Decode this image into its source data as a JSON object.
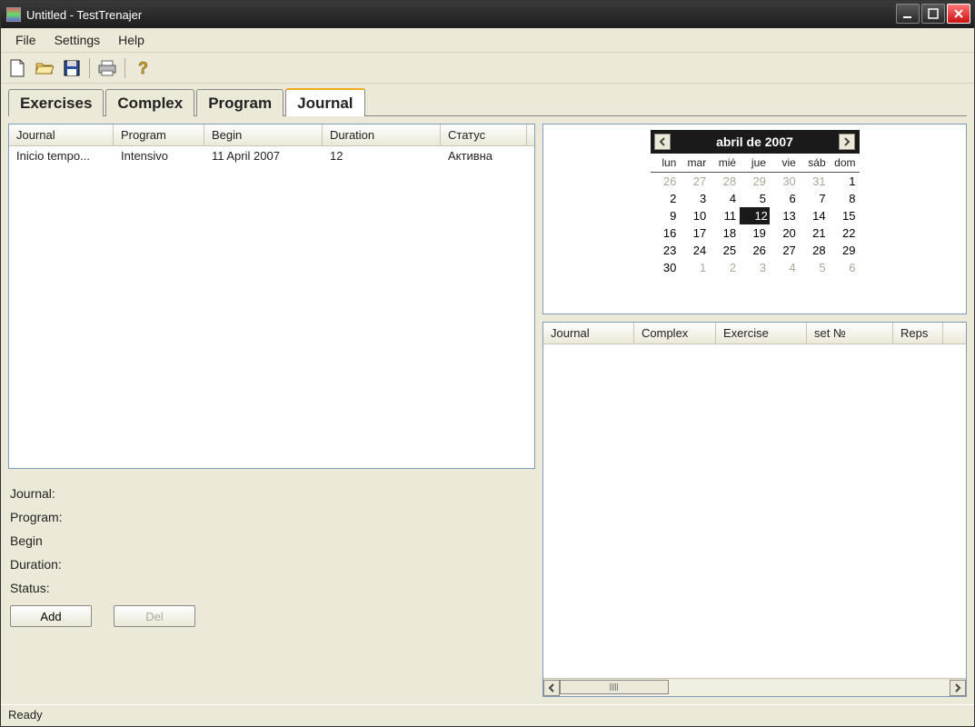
{
  "window": {
    "title": "Untitled - TestTrenajer"
  },
  "menubar": {
    "file": "File",
    "settings": "Settings",
    "help": "Help"
  },
  "toolbar": {
    "new": "new-file-icon",
    "open": "open-file-icon",
    "save": "save-icon",
    "print": "print-icon",
    "help": "help-icon"
  },
  "tabs": {
    "exercises": "Exercises",
    "complex": "Complex",
    "program": "Program",
    "journal": "Journal",
    "active": "journal"
  },
  "journal_list": {
    "columns": {
      "journal": "Journal",
      "program": "Program",
      "begin": "Begin",
      "duration": "Duration",
      "status": "Статус"
    },
    "rows": [
      {
        "journal": "Inicio tempo...",
        "program": "Intensivo",
        "begin": "11 April 2007",
        "duration": "12",
        "status": "Активна"
      }
    ]
  },
  "form": {
    "journal_label": "Journal:",
    "program_label": "Program:",
    "begin_label": "Begin",
    "duration_label": "Duration:",
    "status_label": "Status:",
    "add_btn": "Add",
    "del_btn": "Del"
  },
  "calendar": {
    "title": "abril de 2007",
    "dow": [
      "lun",
      "mar",
      "mié",
      "jue",
      "vie",
      "sáb",
      "dom"
    ],
    "cells": [
      {
        "d": "26",
        "o": true
      },
      {
        "d": "27",
        "o": true
      },
      {
        "d": "28",
        "o": true
      },
      {
        "d": "29",
        "o": true
      },
      {
        "d": "30",
        "o": true
      },
      {
        "d": "31",
        "o": true
      },
      {
        "d": "1"
      },
      {
        "d": "2"
      },
      {
        "d": "3"
      },
      {
        "d": "4"
      },
      {
        "d": "5"
      },
      {
        "d": "6"
      },
      {
        "d": "7"
      },
      {
        "d": "8"
      },
      {
        "d": "9"
      },
      {
        "d": "10"
      },
      {
        "d": "11"
      },
      {
        "d": "12",
        "sel": true
      },
      {
        "d": "13"
      },
      {
        "d": "14"
      },
      {
        "d": "15"
      },
      {
        "d": "16"
      },
      {
        "d": "17"
      },
      {
        "d": "18"
      },
      {
        "d": "19"
      },
      {
        "d": "20"
      },
      {
        "d": "21"
      },
      {
        "d": "22"
      },
      {
        "d": "23"
      },
      {
        "d": "24"
      },
      {
        "d": "25"
      },
      {
        "d": "26"
      },
      {
        "d": "27"
      },
      {
        "d": "28"
      },
      {
        "d": "29"
      },
      {
        "d": "30"
      },
      {
        "d": "1",
        "o": true
      },
      {
        "d": "2",
        "o": true
      },
      {
        "d": "3",
        "o": true
      },
      {
        "d": "4",
        "o": true
      },
      {
        "d": "5",
        "o": true
      },
      {
        "d": "6",
        "o": true
      }
    ]
  },
  "detail_list": {
    "columns": {
      "journal": "Journal",
      "complex": "Complex",
      "exercise": "Exercise",
      "set_no": "set №",
      "reps": "Reps"
    }
  },
  "statusbar": {
    "text": "Ready"
  }
}
